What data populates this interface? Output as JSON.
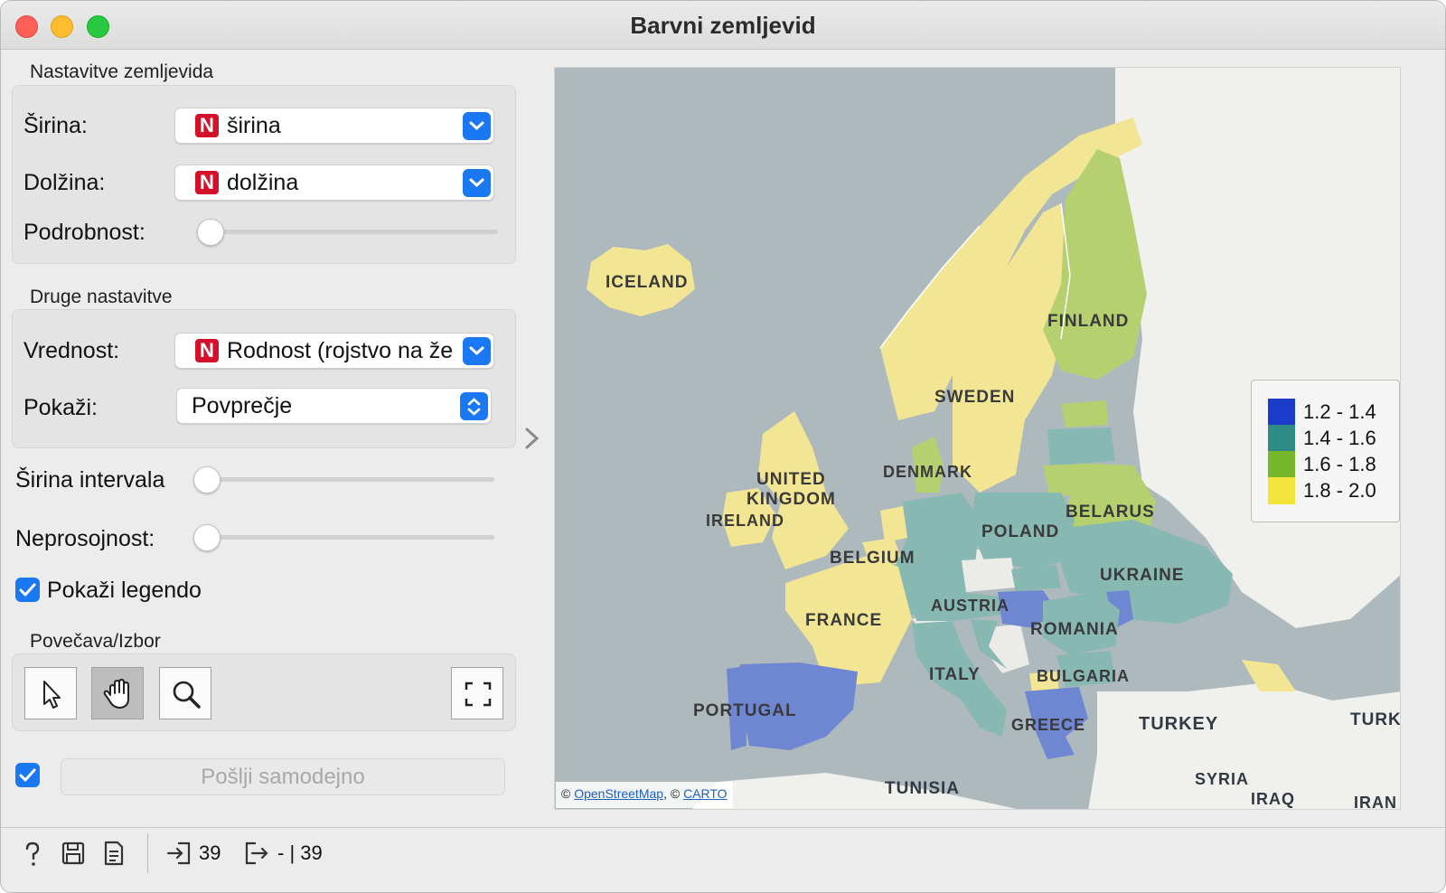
{
  "window": {
    "title": "Barvni zemljevid"
  },
  "map_settings": {
    "section_label": "Nastavitve zemljevida",
    "latitude_label": "Širina:",
    "latitude_value": "širina",
    "longitude_label": "Dolžina:",
    "longitude_value": "dolžina",
    "detail_label": "Podrobnost:",
    "detail_level": 0
  },
  "other_settings": {
    "section_label": "Druge nastavitve",
    "value_label": "Vrednost:",
    "value_value": "Rodnost (rojstvo na že",
    "show_label": "Pokaži:",
    "show_value": "Povprečje"
  },
  "bin_width_label": "Širina intervala",
  "bin_width_level": 0,
  "opacity_label": "Neprosojnost:",
  "opacity_level": 0,
  "show_legend": {
    "label": "Pokaži legendo",
    "checked": true
  },
  "zoom_select": {
    "section_label": "Povečava/Izbor",
    "tools": [
      "select-pointer-icon",
      "pan-hand-icon",
      "zoom-magnifier-icon",
      "fit-fullscreen-icon"
    ],
    "active_tool": "pan-hand-icon"
  },
  "send": {
    "auto_checked": true,
    "label": "Pošlji samodejno"
  },
  "legend": {
    "items": [
      {
        "label": "1.2 - 1.4",
        "color": "#1a3cc8"
      },
      {
        "label": "1.4 - 1.6",
        "color": "#2e8a85"
      },
      {
        "label": "1.6 - 1.8",
        "color": "#76b82a"
      },
      {
        "label": "1.8 - 2.0",
        "color": "#f2e43a"
      }
    ]
  },
  "attribution": {
    "prefix": "©",
    "osm": "OpenStreetMap",
    "sep": ", ©",
    "carto": "CARTO"
  },
  "map_labels": {
    "iceland": "ICELAND",
    "finland": "FINLAND",
    "sweden": "SWEDEN",
    "denmark": "DENMARK",
    "uk1": "UNITED",
    "uk2": "KINGDOM",
    "ireland": "IRELAND",
    "belarus": "BELARUS",
    "poland": "POLAND",
    "belgium": "BELGIUM",
    "ukraine": "UKRAINE",
    "austria": "AUSTRIA",
    "france": "FRANCE",
    "romania": "ROMANIA",
    "italy": "ITALY",
    "bulgaria": "BULGARIA",
    "portugal": "PORTUGAL",
    "greece": "GREECE",
    "turkey": "TURKEY",
    "turk2": "TURK",
    "syria": "SYRIA",
    "tunisia": "TUNISIA",
    "iraq": "IRAQ",
    "iran": "IRAN"
  },
  "status": {
    "input_count": "39",
    "output_count": "- | 39"
  }
}
